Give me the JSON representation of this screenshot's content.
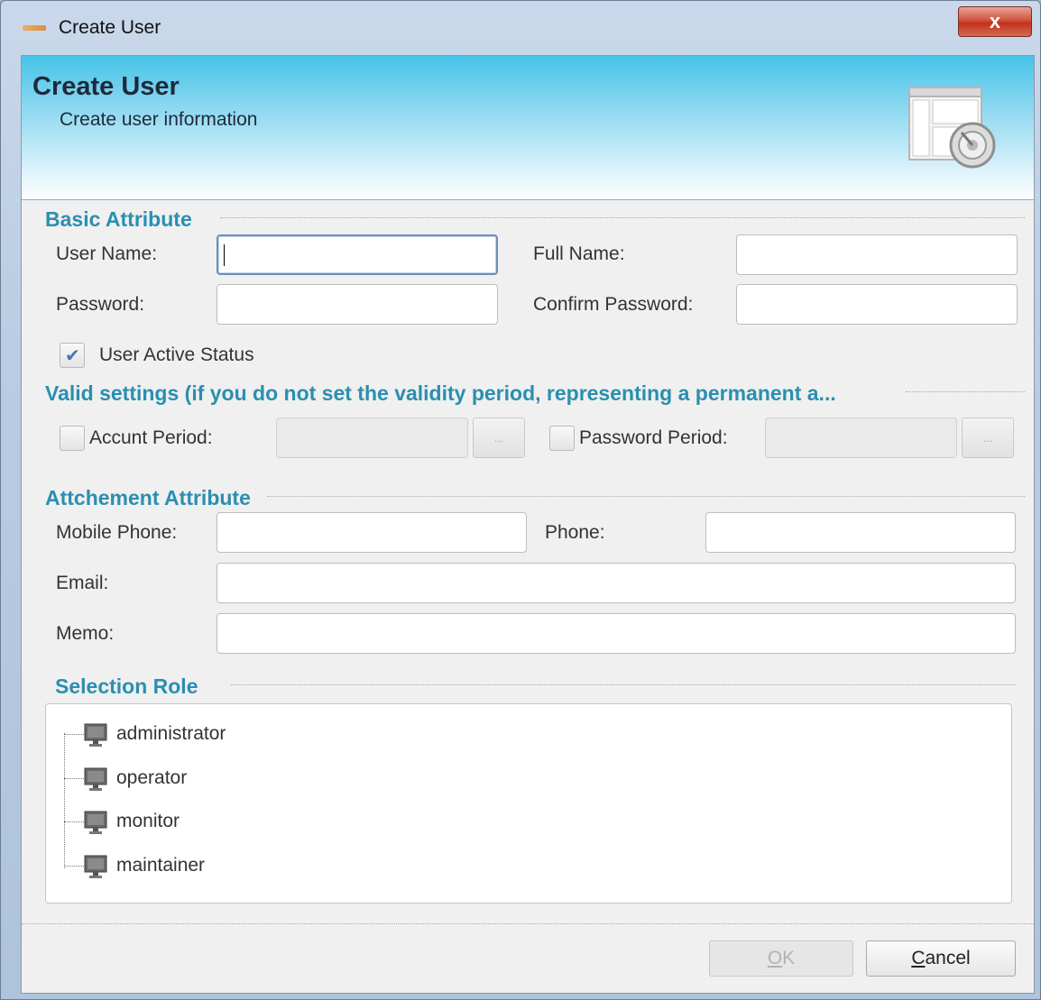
{
  "window": {
    "title": "Create User",
    "close_glyph": "x"
  },
  "header": {
    "title": "Create User",
    "subtitle": "Create user information",
    "icon": "settings-window-icon"
  },
  "basic": {
    "title": "Basic Attribute",
    "user_name_label": "User Name:",
    "full_name_label": "Full Name:",
    "password_label": "Password:",
    "confirm_password_label": "Confirm Password:",
    "active_status_label": "User Active Status",
    "active_status_checked": true
  },
  "validity": {
    "title": "Valid settings (if you do not set the validity period, representing a permanent a...",
    "account_period_label": "Accunt Period:",
    "password_period_label": "Password Period:",
    "ellipsis": "..."
  },
  "attachment": {
    "title": "Attchement Attribute",
    "mobile_phone_label": "Mobile Phone:",
    "phone_label": "Phone:",
    "email_label": "Email:",
    "memo_label": "Memo:"
  },
  "roles": {
    "title": "Selection Role",
    "items": [
      {
        "label": "administrator",
        "icon": "computer-icon"
      },
      {
        "label": "operator",
        "icon": "computer-icon"
      },
      {
        "label": "monitor",
        "icon": "computer-icon"
      },
      {
        "label": "maintainer",
        "icon": "computer-icon"
      }
    ]
  },
  "buttons": {
    "ok_first": "O",
    "ok_rest": "K",
    "cancel_first": "C",
    "cancel_rest": "ancel"
  },
  "colors": {
    "section_title": "#2a8fb0",
    "banner_top": "#45c3e8",
    "close_button": "#c2321c"
  }
}
